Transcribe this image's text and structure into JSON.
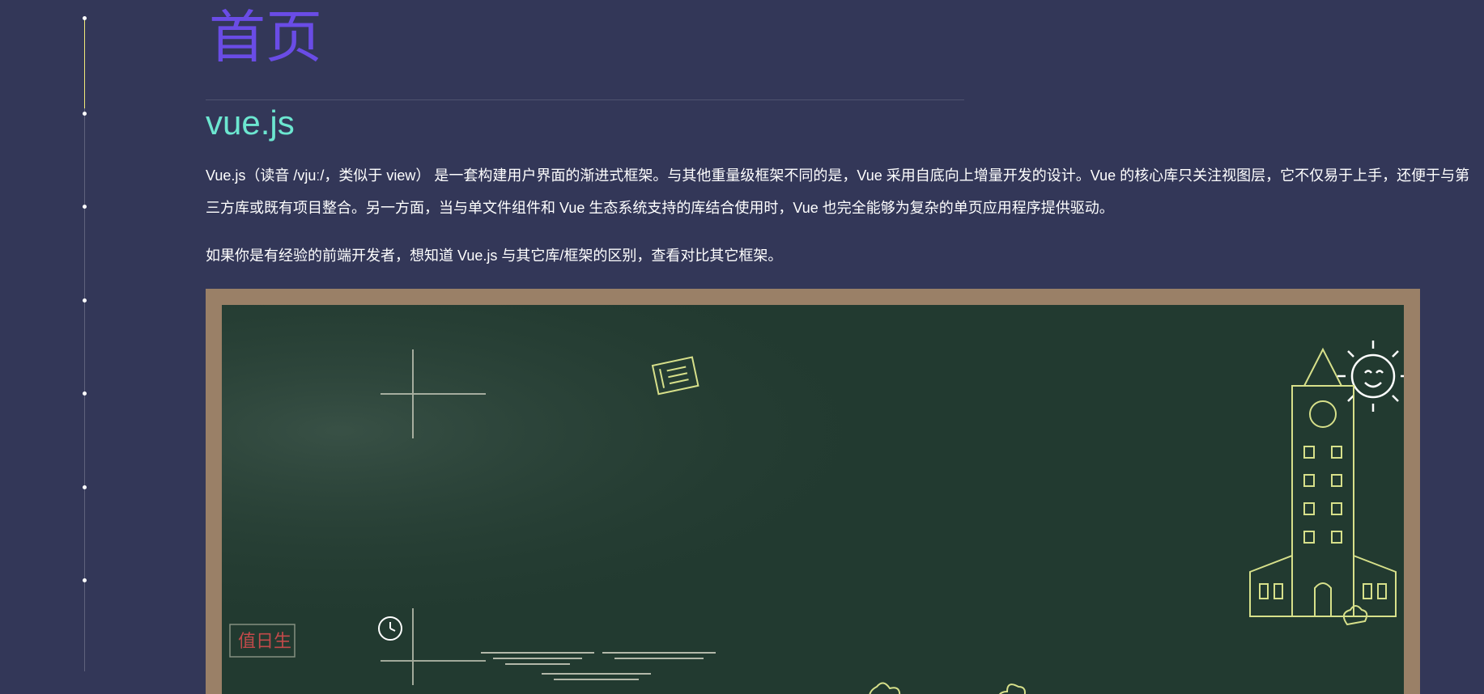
{
  "page": {
    "title": "首页",
    "section_title": "vue.js",
    "paragraphs": [
      "Vue.js（读音 /vjuː/，类似于 view） 是一套构建用户界面的渐进式框架。与其他重量级框架不同的是，Vue 采用自底向上增量开发的设计。Vue 的核心库只关注视图层，它不仅易于上手，还便于与第三方库或既有项目整合。另一方面，当与单文件组件和 Vue 生态系统支持的库结合使用时，Vue 也完全能够为复杂的单页应用程序提供驱动。",
      "如果你是有经验的前端开发者，想知道 Vue.js 与其它库/框架的区别，查看对比其它框架。"
    ]
  },
  "timeline": {
    "dot_count": 7,
    "active_index": 0
  },
  "board": {
    "sign_text": "值日生"
  },
  "colors": {
    "background": "#333758",
    "title": "#6a4ce6",
    "section_title": "#6ce6d0",
    "rail_active": "#f1ea7a",
    "board": "#223a30",
    "board_frame": "#9a8067",
    "chalk": "#d7e08a"
  },
  "icons": [
    "book-doodle-icon",
    "sun-doodle-icon",
    "clock-doodle-icon",
    "castle-doodle-icon",
    "flower-doodle-icon"
  ]
}
